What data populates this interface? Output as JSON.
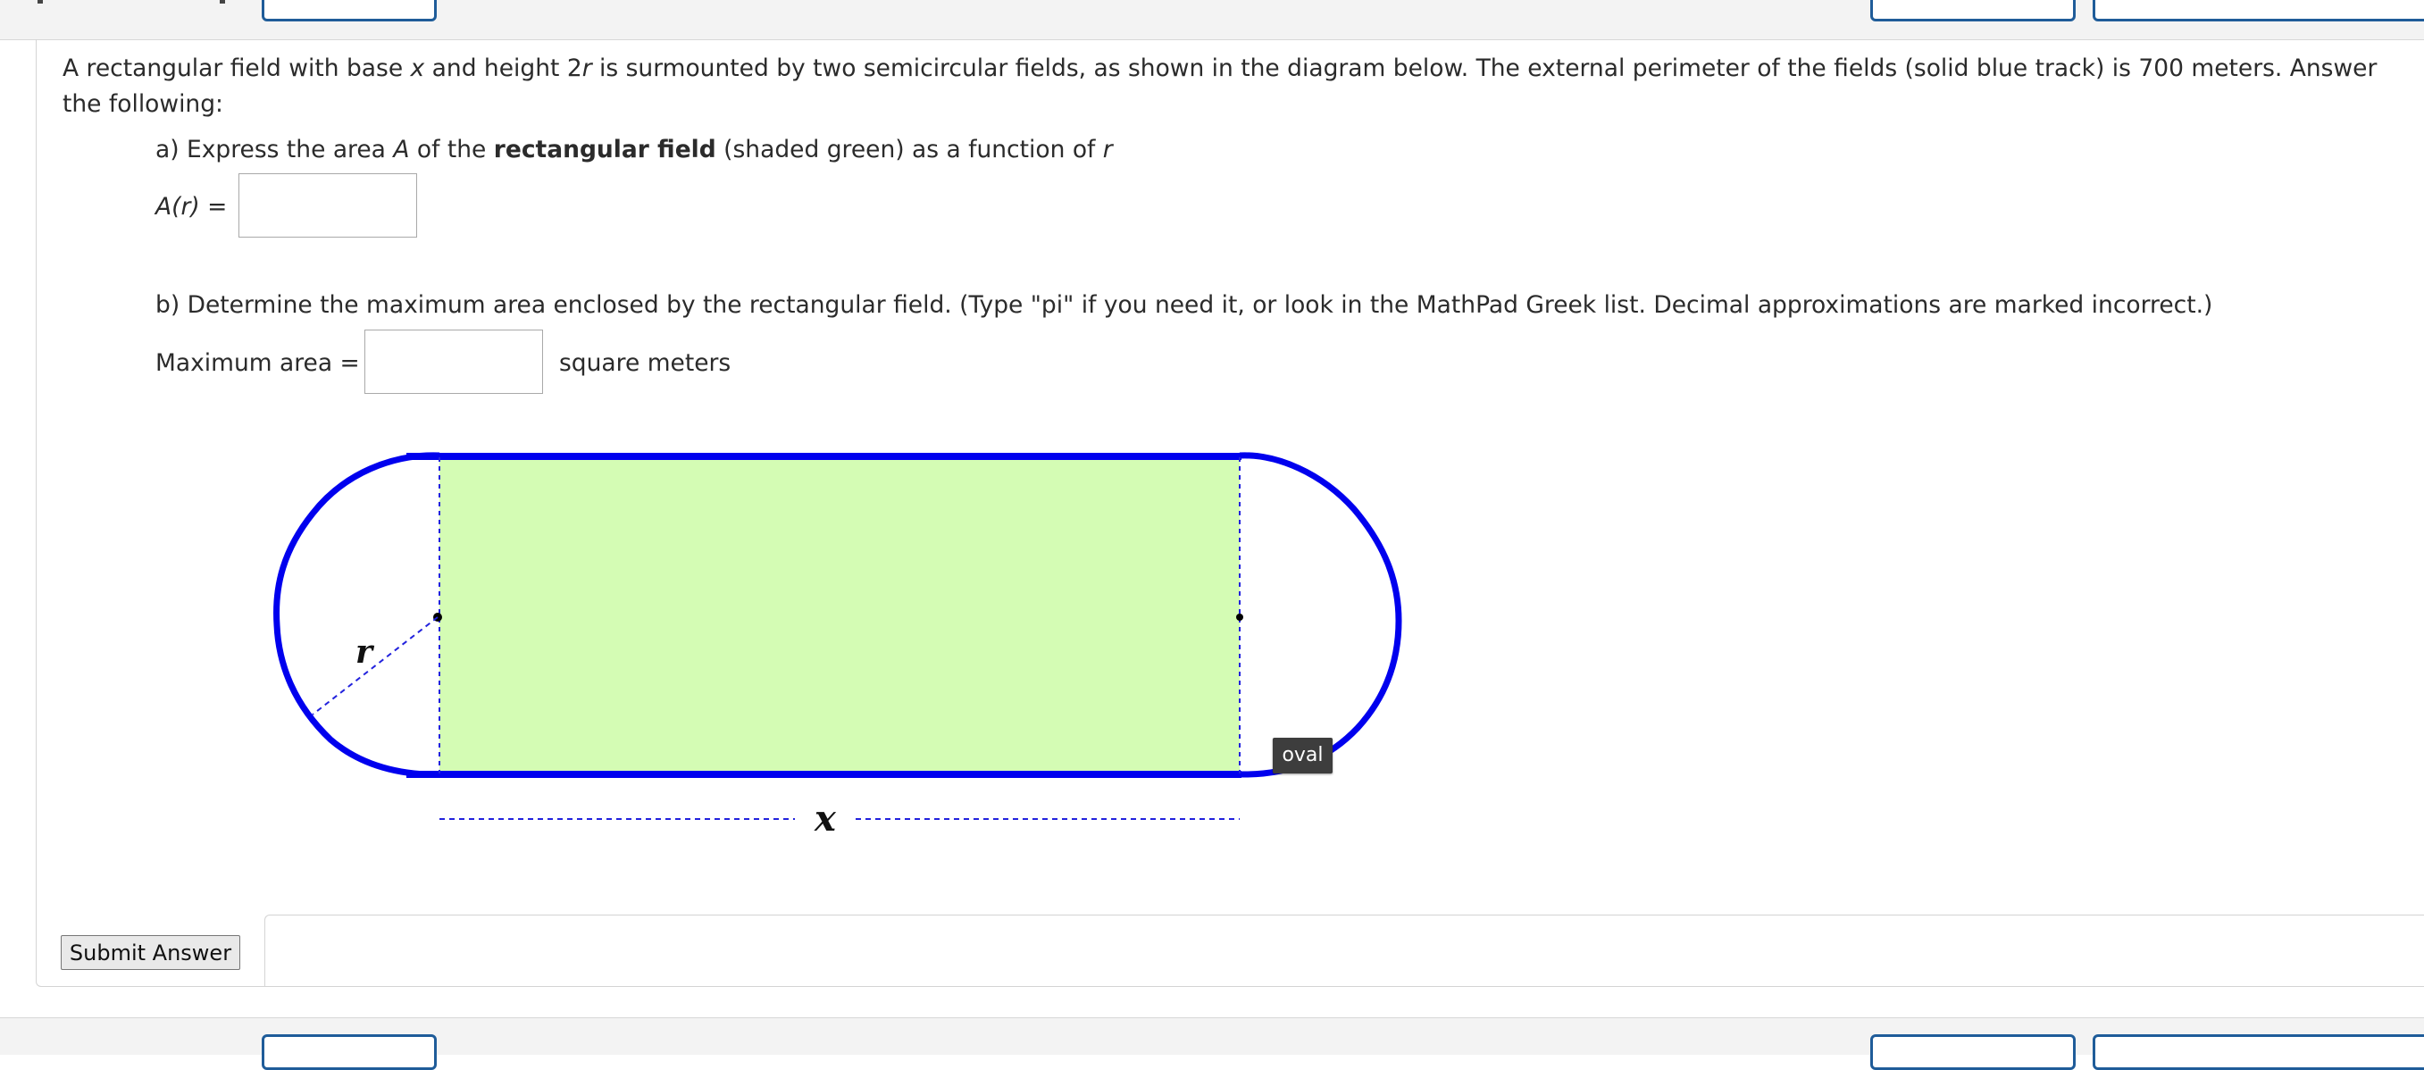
{
  "question": {
    "intro_parts": [
      "A rectangular field with base ",
      "x",
      " and height 2",
      "r",
      " is surmounted by two semicircular fields, as shown in the diagram below. The external perimeter of the fields (solid blue track) is 700 meters. Answer the following:"
    ],
    "part_a": {
      "prefix": "a) Express the area ",
      "var_a": "A",
      "middle": " of the ",
      "bold": "rectangular field",
      "suffix": " (shaded green) as a function of ",
      "var_r": "r",
      "answer_label": "A(r) =",
      "answer_value": ""
    },
    "part_b": {
      "text": "b) Determine the maximum area enclosed by the rectangular field. (Type \"pi\" if you need it, or look in the MathPad Greek list. Decimal approximations are marked incorrect.)",
      "answer_label": "Maximum area =",
      "answer_value": "",
      "units": "square meters"
    }
  },
  "diagram": {
    "radius_label": "r",
    "base_label": "x",
    "tooltip": "oval",
    "colors": {
      "track": "#0000ee",
      "rectangle_fill": "#d4fcb4",
      "dashed": "#2222dd"
    }
  },
  "submit": {
    "label": "Submit Answer"
  }
}
